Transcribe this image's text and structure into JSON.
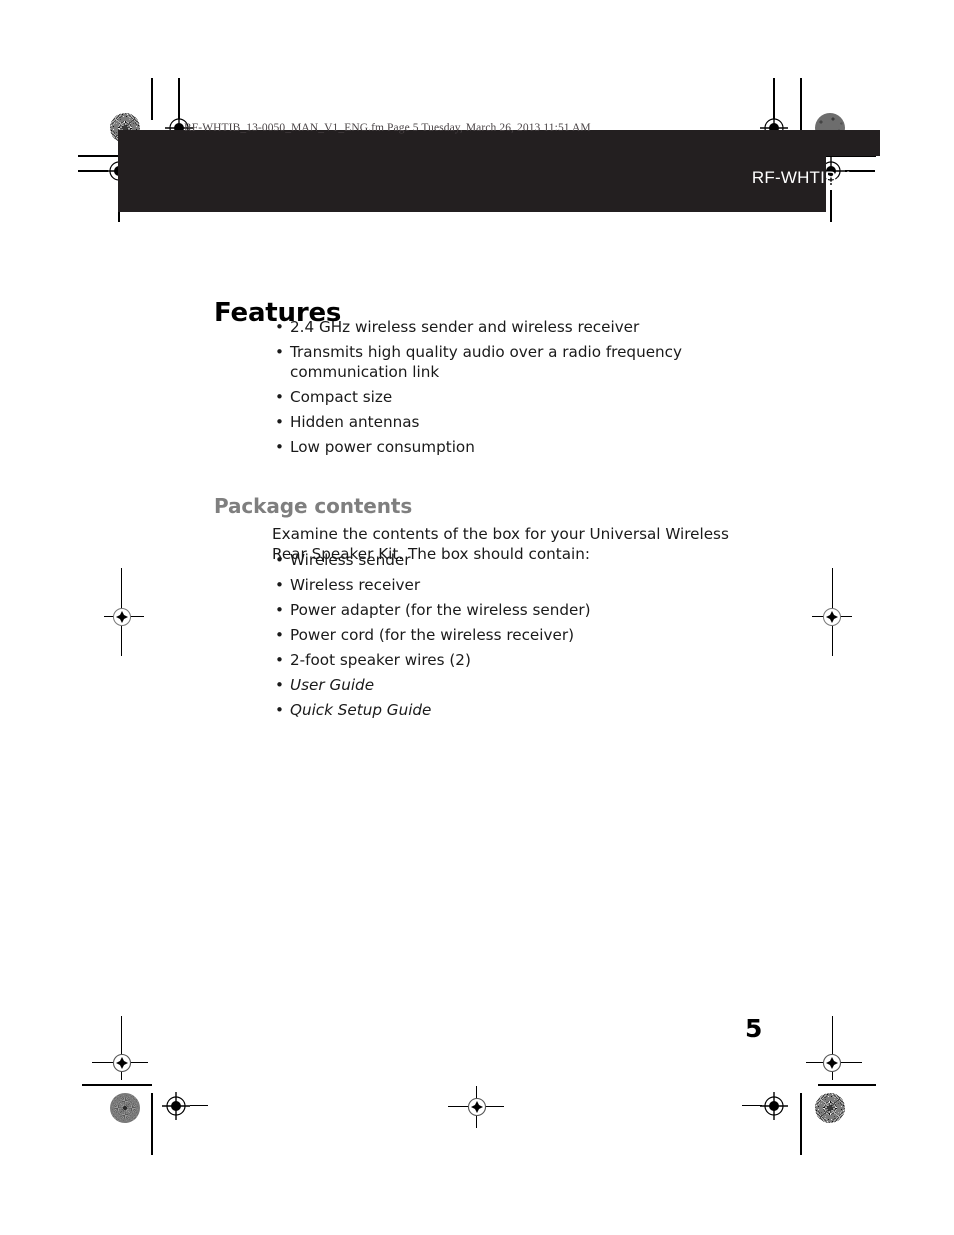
{
  "document": {
    "framemaker_stamp": "RF-WHTIB_13-0050_MAN_V1_ENG.fm  Page 5  Tuesday, March 26, 2013  11:51 AM",
    "header_model": "RF-WHTIB-A",
    "page_number": "5"
  },
  "features": {
    "heading": "Features",
    "items": [
      "2.4 GHz wireless sender and wireless receiver",
      "Transmits high quality audio over a radio frequency communication link",
      "Compact size",
      "Hidden antennas",
      "Low power consumption"
    ]
  },
  "package_contents": {
    "heading": "Package contents",
    "intro": "Examine the contents of the box for your Universal Wireless Rear Speaker Kit. The box should contain:",
    "items": [
      "Wireless sender",
      "Wireless receiver",
      "Power adapter (for the wireless sender)",
      "Power cord (for the wireless receiver)",
      "2-foot speaker wires (2)",
      "User Guide",
      "Quick Setup Guide"
    ]
  },
  "bullet_glyph": "•",
  "colors": {
    "band": "#231f20",
    "heading_primary": "#000000",
    "heading_secondary": "#7f7f7f",
    "body_text": "#1a1a1a",
    "header_model_text": "#ffffff",
    "page_background": "#ffffff"
  }
}
